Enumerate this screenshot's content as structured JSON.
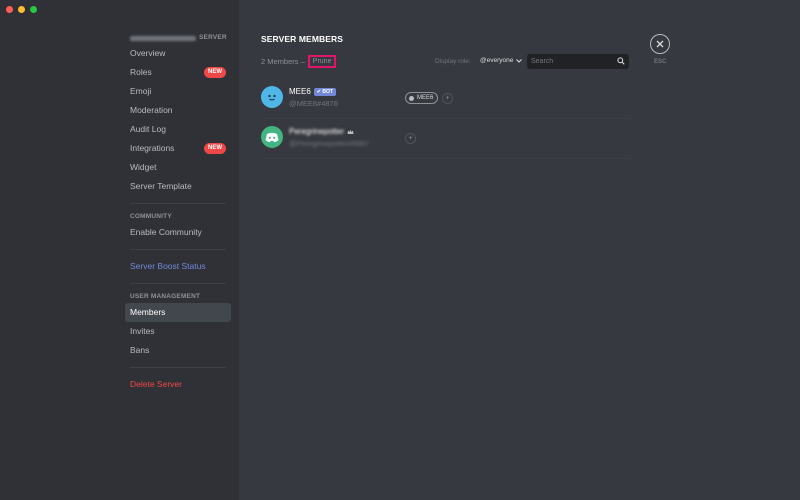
{
  "window": {
    "controls": [
      "close",
      "minimize",
      "maximize"
    ]
  },
  "sidebar": {
    "server_header": "SERVER",
    "items_top": [
      {
        "label": "Overview",
        "badge": ""
      },
      {
        "label": "Roles",
        "badge": "NEW"
      },
      {
        "label": "Emoji",
        "badge": ""
      },
      {
        "label": "Moderation",
        "badge": ""
      },
      {
        "label": "Audit Log",
        "badge": ""
      },
      {
        "label": "Integrations",
        "badge": "NEW"
      },
      {
        "label": "Widget",
        "badge": ""
      },
      {
        "label": "Server Template",
        "badge": ""
      }
    ],
    "community_header": "COMMUNITY",
    "enable_community": "Enable Community",
    "server_boost_status": "Server Boost Status",
    "user_management_header": "USER MANAGEMENT",
    "user_items": [
      {
        "label": "Members",
        "active": true
      },
      {
        "label": "Invites",
        "active": false
      },
      {
        "label": "Bans",
        "active": false
      }
    ],
    "delete_server": "Delete Server"
  },
  "main": {
    "title": "SERVER MEMBERS",
    "member_count": "2 Members –",
    "prune_label": "Prune",
    "display_role_label": "Display role:",
    "display_role_value": "@everyone",
    "search_placeholder": "Search",
    "esc_label": "ESC",
    "members": [
      {
        "name": "MEE6",
        "bot_tag": "✔ BOT",
        "tag": "@MEE6#4876",
        "role": "MEE6"
      },
      {
        "name": "Peregrinepotter",
        "tag": "@Peregrinepotter#9987"
      }
    ]
  },
  "colors": {
    "accent": "#7289da",
    "danger": "#f04747",
    "highlight": "#e3156b",
    "online": "#43b581"
  }
}
